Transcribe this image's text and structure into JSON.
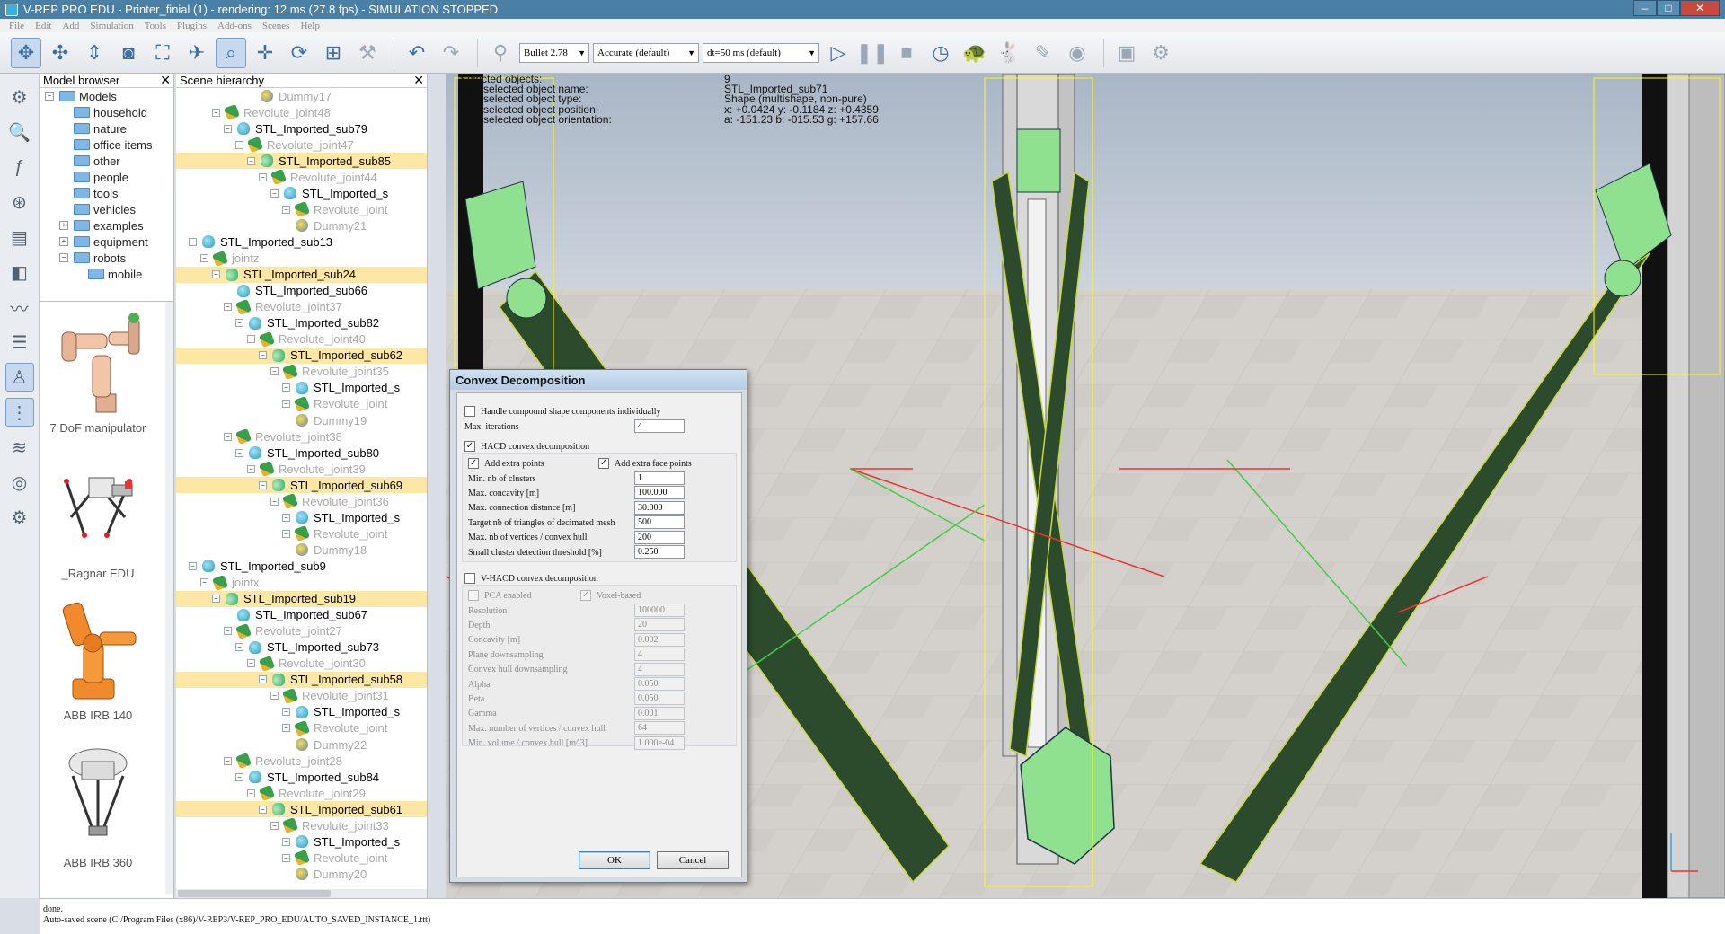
{
  "window": {
    "title": "V-REP PRO EDU - Printer_finial (1) - rendering: 12 ms (27.8 fps) - SIMULATION STOPPED",
    "minimize": "–",
    "maximize": "□",
    "close": "✕"
  },
  "menu": [
    "File",
    "Edit",
    "Add",
    "Simulation",
    "Tools",
    "Plugins",
    "Add-ons",
    "Scenes",
    "Help"
  ],
  "toolbar": {
    "engine": "Bullet 2.78",
    "accuracy": "Accurate (default)",
    "timestep": "dt=50 ms (default)",
    "icons": [
      "camera-pan-icon",
      "camera-rotate-icon",
      "camera-shift-icon",
      "camera-angle-icon",
      "fit-to-view-icon",
      "fly-icon",
      "object-select-icon",
      "object-move-icon",
      "object-rotate-icon",
      "assemble-icon",
      "transfer-dna-icon",
      "undo-icon",
      "redo-icon",
      "dynamics-icon",
      "play-icon",
      "pause-icon",
      "stop-icon",
      "realtime-icon",
      "slow-down-icon",
      "speed-up-icon",
      "thread-rendering-icon",
      "visualization-icon",
      "page-selector-icon",
      "scene-selector-icon"
    ]
  },
  "left_toolbar": [
    "simulation-settings-icon",
    "zoom-icon",
    "calculation-modules-icon",
    "collections-icon",
    "scripts-icon",
    "shape-edit-icon",
    "path-edit-icon",
    "selection-icon",
    "model-browser-icon",
    "scene-hierarchy-icon",
    "layers-icon",
    "video-recorder-icon",
    "user-settings-icon"
  ],
  "model_browser": {
    "header": "Model browser",
    "tree": [
      {
        "label": "Models",
        "level": 0,
        "exp": "−"
      },
      {
        "label": "household",
        "level": 1
      },
      {
        "label": "nature",
        "level": 1
      },
      {
        "label": "office items",
        "level": 1
      },
      {
        "label": "other",
        "level": 1
      },
      {
        "label": "people",
        "level": 1
      },
      {
        "label": "tools",
        "level": 1
      },
      {
        "label": "vehicles",
        "level": 1
      },
      {
        "label": "examples",
        "level": 1,
        "exp": "+"
      },
      {
        "label": "equipment",
        "level": 1,
        "exp": "+"
      },
      {
        "label": "robots",
        "level": 1,
        "exp": "−"
      },
      {
        "label": "mobile",
        "level": 2
      }
    ],
    "thumbnails": [
      "7 DoF manipulator",
      "_Ragnar EDU",
      "ABB IRB 140",
      "ABB IRB 360"
    ]
  },
  "scene_hierarchy": {
    "header": "Scene hierarchy",
    "rows": [
      {
        "label": "Dummy17",
        "indent": 5,
        "icon": "dummy",
        "dim": true
      },
      {
        "label": "Revolute_joint48",
        "indent": 2,
        "icon": "joint",
        "dim": true,
        "exp": "−"
      },
      {
        "label": "STL_Imported_sub79",
        "indent": 3,
        "icon": "shape",
        "exp": "−"
      },
      {
        "label": "Revolute_joint47",
        "indent": 4,
        "icon": "joint",
        "dim": true,
        "exp": "−"
      },
      {
        "label": "STL_Imported_sub85",
        "indent": 5,
        "icon": "compound",
        "sel": true,
        "exp": "−"
      },
      {
        "label": "Revolute_joint44",
        "indent": 6,
        "icon": "joint",
        "dim": true,
        "exp": "−"
      },
      {
        "label": "STL_Imported_s",
        "indent": 7,
        "icon": "shape",
        "exp": "−"
      },
      {
        "label": "Revolute_joint",
        "indent": 8,
        "icon": "joint",
        "dim": true,
        "exp": "−"
      },
      {
        "label": "Dummy21",
        "indent": 8,
        "icon": "dummy",
        "dim": true
      },
      {
        "label": "STL_Imported_sub13",
        "indent": 0,
        "icon": "shape",
        "exp": "−"
      },
      {
        "label": "jointz",
        "indent": 1,
        "icon": "joint",
        "dim": true,
        "exp": "−"
      },
      {
        "label": "STL_Imported_sub24",
        "indent": 2,
        "icon": "compound",
        "sel": true,
        "exp": "−"
      },
      {
        "label": "STL_Imported_sub66",
        "indent": 3,
        "icon": "shape"
      },
      {
        "label": "Revolute_joint37",
        "indent": 3,
        "icon": "joint",
        "dim": true,
        "exp": "−"
      },
      {
        "label": "STL_Imported_sub82",
        "indent": 4,
        "icon": "shape",
        "exp": "−"
      },
      {
        "label": "Revolute_joint40",
        "indent": 5,
        "icon": "joint",
        "dim": true,
        "exp": "−"
      },
      {
        "label": "STL_Imported_sub62",
        "indent": 6,
        "icon": "compound",
        "sel": true,
        "exp": "−"
      },
      {
        "label": "Revolute_joint35",
        "indent": 7,
        "icon": "joint",
        "dim": true,
        "exp": "−"
      },
      {
        "label": "STL_Imported_s",
        "indent": 8,
        "icon": "shape",
        "exp": "−"
      },
      {
        "label": "Revolute_joint",
        "indent": 8,
        "icon": "joint",
        "dim": true,
        "exp": "−"
      },
      {
        "label": "Dummy19",
        "indent": 8,
        "icon": "dummy",
        "dim": true
      },
      {
        "label": "Revolute_joint38",
        "indent": 3,
        "icon": "joint",
        "dim": true,
        "exp": "−"
      },
      {
        "label": "STL_Imported_sub80",
        "indent": 4,
        "icon": "shape",
        "exp": "−"
      },
      {
        "label": "Revolute_joint39",
        "indent": 5,
        "icon": "joint",
        "dim": true,
        "exp": "−"
      },
      {
        "label": "STL_Imported_sub69",
        "indent": 6,
        "icon": "compound",
        "sel": true,
        "exp": "−"
      },
      {
        "label": "Revolute_joint36",
        "indent": 7,
        "icon": "joint",
        "dim": true,
        "exp": "−"
      },
      {
        "label": "STL_Imported_s",
        "indent": 8,
        "icon": "shape",
        "exp": "−"
      },
      {
        "label": "Revolute_joint",
        "indent": 8,
        "icon": "joint",
        "dim": true,
        "exp": "−"
      },
      {
        "label": "Dummy18",
        "indent": 8,
        "icon": "dummy",
        "dim": true
      },
      {
        "label": "STL_Imported_sub9",
        "indent": 0,
        "icon": "shape",
        "exp": "−"
      },
      {
        "label": "jointx",
        "indent": 1,
        "icon": "joint",
        "dim": true,
        "exp": "−"
      },
      {
        "label": "STL_Imported_sub19",
        "indent": 2,
        "icon": "compound",
        "sel": true,
        "exp": "−"
      },
      {
        "label": "STL_Imported_sub67",
        "indent": 3,
        "icon": "shape"
      },
      {
        "label": "Revolute_joint27",
        "indent": 3,
        "icon": "joint",
        "dim": true,
        "exp": "−"
      },
      {
        "label": "STL_Imported_sub73",
        "indent": 4,
        "icon": "shape",
        "exp": "−"
      },
      {
        "label": "Revolute_joint30",
        "indent": 5,
        "icon": "joint",
        "dim": true,
        "exp": "−"
      },
      {
        "label": "STL_Imported_sub58",
        "indent": 6,
        "icon": "compound",
        "sel": true,
        "exp": "−"
      },
      {
        "label": "Revolute_joint31",
        "indent": 7,
        "icon": "joint",
        "dim": true,
        "exp": "−"
      },
      {
        "label": "STL_Imported_s",
        "indent": 8,
        "icon": "shape",
        "exp": "−"
      },
      {
        "label": "Revolute_joint",
        "indent": 8,
        "icon": "joint",
        "dim": true,
        "exp": "−"
      },
      {
        "label": "Dummy22",
        "indent": 8,
        "icon": "dummy",
        "dim": true
      },
      {
        "label": "Revolute_joint28",
        "indent": 3,
        "icon": "joint",
        "dim": true,
        "exp": "−"
      },
      {
        "label": "STL_Imported_sub84",
        "indent": 4,
        "icon": "shape",
        "exp": "−"
      },
      {
        "label": "Revolute_joint29",
        "indent": 5,
        "icon": "joint",
        "dim": true,
        "exp": "−"
      },
      {
        "label": "STL_Imported_sub61",
        "indent": 6,
        "icon": "compound",
        "sel": true,
        "exp": "−"
      },
      {
        "label": "Revolute_joint33",
        "indent": 7,
        "icon": "joint",
        "dim": true,
        "exp": "−"
      },
      {
        "label": "STL_Imported_s",
        "indent": 8,
        "icon": "shape",
        "exp": "−"
      },
      {
        "label": "Revolute_joint",
        "indent": 8,
        "icon": "joint",
        "dim": true,
        "exp": "−"
      },
      {
        "label": "Dummy20",
        "indent": 8,
        "icon": "dummy",
        "dim": true
      }
    ]
  },
  "viewport_info": [
    {
      "label": "Selected objects:",
      "value": "9"
    },
    {
      "label": "Last selected object name:",
      "value": "STL_Imported_sub71"
    },
    {
      "label": "Last selected object type:",
      "value": "Shape (multishape, non-pure)"
    },
    {
      "label": "Last selected object position:",
      "value": "x: +0.0424   y: -0.1184   z: +0.4359"
    },
    {
      "label": "Last selected object orientation:",
      "value": "a: -151.23   b: -015.53   g: +157.66"
    }
  ],
  "dialog": {
    "title": "Convex Decomposition",
    "handle_individually": "Handle compound shape components individually",
    "max_iterations_label": "Max. iterations",
    "max_iterations": "4",
    "hacd_label": "HACD convex decomposition",
    "add_extra_points": "Add extra points",
    "add_extra_face_points": "Add extra face points",
    "hacd_fields": [
      {
        "label": "Min. nb of clusters",
        "value": "1"
      },
      {
        "label": "Max. concavity [m]",
        "value": "100.000"
      },
      {
        "label": "Max. connection distance [m]",
        "value": "30.000"
      },
      {
        "label": "Target nb of triangles of decimated mesh",
        "value": "500"
      },
      {
        "label": "Max. nb of vertices / convex hull",
        "value": "200"
      },
      {
        "label": "Small cluster detection threshold [%]",
        "value": "0.250"
      }
    ],
    "vhacd_label": "V-HACD convex decomposition",
    "pca_enabled": "PCA enabled",
    "voxel_based": "Voxel-based",
    "vhacd_fields": [
      {
        "label": "Resolution",
        "value": "100000"
      },
      {
        "label": "Depth",
        "value": "20"
      },
      {
        "label": "Concavity [m]",
        "value": "0.002"
      },
      {
        "label": "Plane downsampling",
        "value": "4"
      },
      {
        "label": "Convex hull downsampling",
        "value": "4"
      },
      {
        "label": "Alpha",
        "value": "0.050"
      },
      {
        "label": "Beta",
        "value": "0.050"
      },
      {
        "label": "Gamma",
        "value": "0.001"
      },
      {
        "label": "Max. number of vertices / convex hull",
        "value": "64"
      },
      {
        "label": "Min. volume / convex hull [m^3]",
        "value": "1.000e-04"
      }
    ],
    "ok": "OK",
    "cancel": "Cancel"
  },
  "status": {
    "line1": "done.",
    "line2": "Auto-saved scene (C:/Program Files (x86)/V-REP3/V-REP_PRO_EDU/AUTO_SAVED_INSTANCE_1.ttt)"
  }
}
